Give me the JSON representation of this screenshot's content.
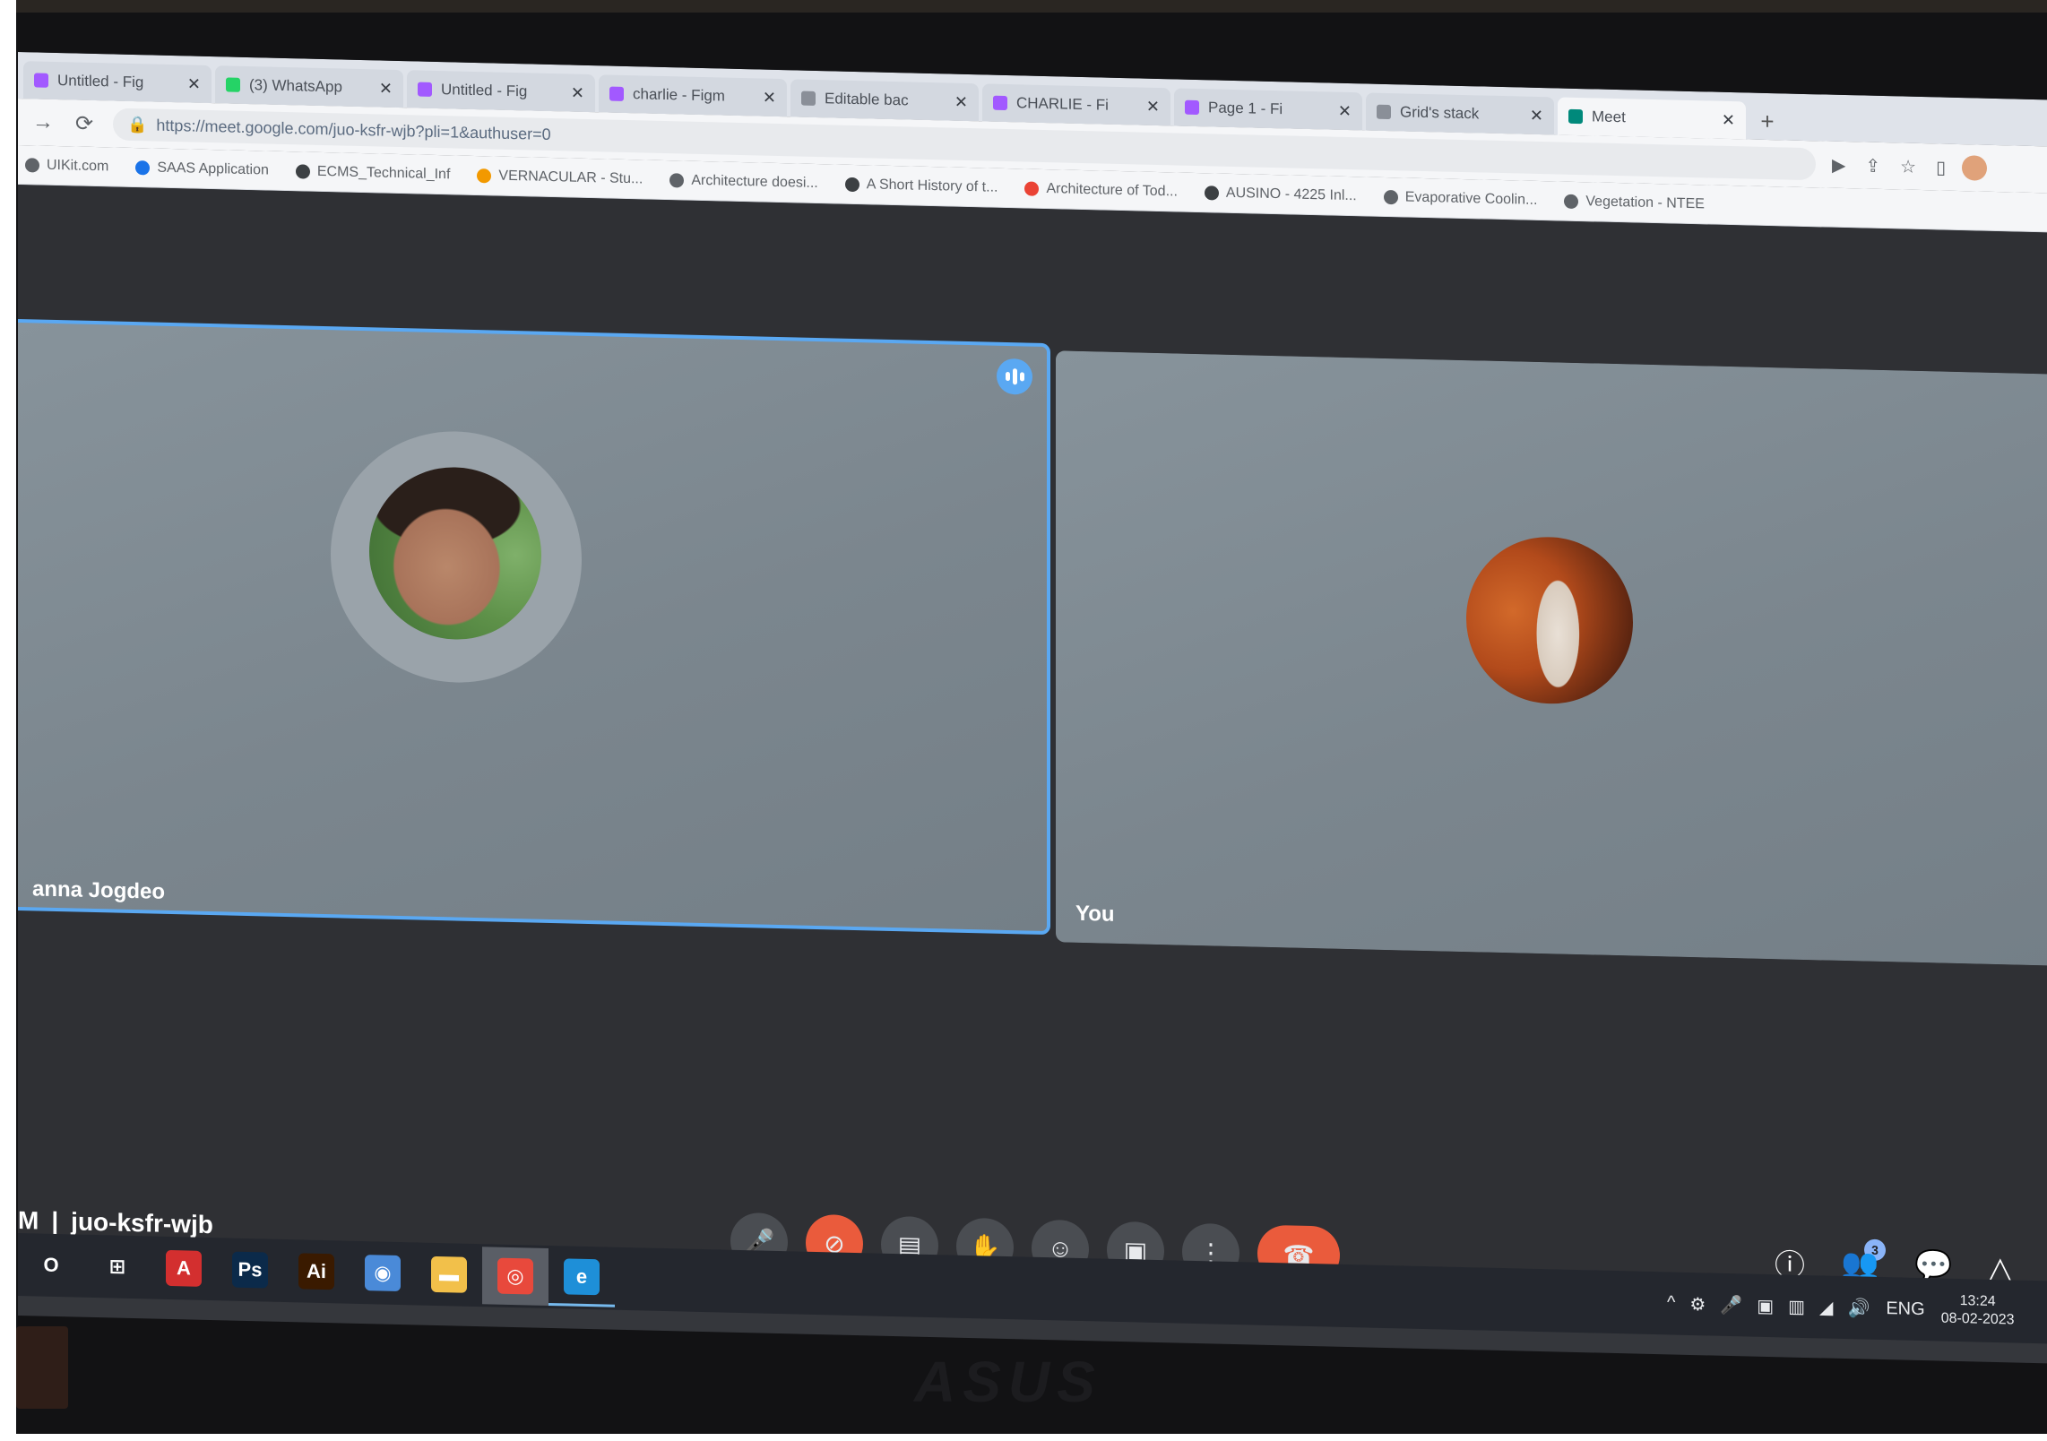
{
  "browser": {
    "tabs": [
      {
        "title": "Untitled - Fig",
        "color": "#a259ff"
      },
      {
        "title": "(3) WhatsApp",
        "color": "#25d366"
      },
      {
        "title": "Untitled - Fig",
        "color": "#a259ff"
      },
      {
        "title": "charlie - Figm",
        "color": "#a259ff"
      },
      {
        "title": "Editable bac",
        "color": "#8a8f98"
      },
      {
        "title": "CHARLIE - Fi",
        "color": "#a259ff"
      },
      {
        "title": "Page 1 - Fi",
        "color": "#a259ff"
      },
      {
        "title": "Grid's stack",
        "color": "#8a8f98"
      },
      {
        "title": "Meet",
        "color": "#00897b",
        "active": true
      }
    ],
    "new_tab": "+",
    "url": "https://meet.google.com/juo-ksfr-wjb?pli=1&authuser=0",
    "bookmarks": [
      {
        "label": "UIKit.com",
        "color": "#5f6368"
      },
      {
        "label": "SAAS Application",
        "color": "#1a73e8"
      },
      {
        "label": "ECMS_Technical_Inf",
        "color": "#3c4043"
      },
      {
        "label": "VERNACULAR - Stu...",
        "color": "#f29900"
      },
      {
        "label": "Architecture doesi...",
        "color": "#5f6368"
      },
      {
        "label": "A Short History of t...",
        "color": "#3c4043"
      },
      {
        "label": "Architecture of Tod...",
        "color": "#ea4335"
      },
      {
        "label": "AUSINO - 4225 Inl...",
        "color": "#3c4043"
      },
      {
        "label": "Evaporative Coolin...",
        "color": "#5f6368"
      },
      {
        "label": "Vegetation - NTEE",
        "color": "#5f6368"
      }
    ]
  },
  "meet": {
    "participants": [
      {
        "name": "anna Jogdeo",
        "speaking": true
      },
      {
        "name": "You",
        "speaking": false
      }
    ],
    "meeting_time": "M",
    "separator": "|",
    "meeting_code": "juo-ksfr-wjb",
    "participant_count": "3",
    "controls": [
      {
        "icon": "microphone-icon",
        "glyph": "🎤"
      },
      {
        "icon": "camera-off-icon",
        "glyph": "⊘"
      },
      {
        "icon": "captions-icon",
        "glyph": "▤"
      },
      {
        "icon": "raise-hand-icon",
        "glyph": "✋"
      },
      {
        "icon": "emoji-icon",
        "glyph": "☺"
      },
      {
        "icon": "present-icon",
        "glyph": "▣"
      },
      {
        "icon": "more-options-icon",
        "glyph": "⋮"
      },
      {
        "icon": "leave-call-icon",
        "glyph": "☎"
      }
    ],
    "right_controls": [
      {
        "icon": "info-icon",
        "glyph": "ⓘ"
      },
      {
        "icon": "people-icon",
        "glyph": "👥"
      },
      {
        "icon": "chat-icon",
        "glyph": "💬"
      },
      {
        "icon": "activities-icon",
        "glyph": "△"
      }
    ]
  },
  "taskbar": {
    "apps": [
      {
        "icon": "search-icon",
        "label": "O",
        "color": "transparent"
      },
      {
        "icon": "task-view-icon",
        "label": "⊞",
        "color": "transparent"
      },
      {
        "icon": "acrobat-icon",
        "label": "A",
        "color": "#d32f2f"
      },
      {
        "icon": "photoshop-icon",
        "label": "Ps",
        "color": "#0b2a4a"
      },
      {
        "icon": "illustrator-icon",
        "label": "Ai",
        "color": "#3a1a00"
      },
      {
        "icon": "app-icon",
        "label": "◉",
        "color": "#4a8ad8"
      },
      {
        "icon": "file-explorer-icon",
        "label": "▬",
        "color": "#f2c04a"
      },
      {
        "icon": "chrome-icon",
        "label": "◎",
        "color": "#e8493c",
        "active": true
      },
      {
        "icon": "edge-icon",
        "label": "e",
        "color": "#1e8fd8",
        "running": true
      }
    ],
    "tray": {
      "items": [
        "^",
        "⚙",
        "🎤",
        "▣",
        "▥",
        "◢",
        "🔊"
      ],
      "language": "ENG",
      "time": "13:24",
      "date": "08-02-2023"
    }
  },
  "device": {
    "brand": "ASUS"
  }
}
